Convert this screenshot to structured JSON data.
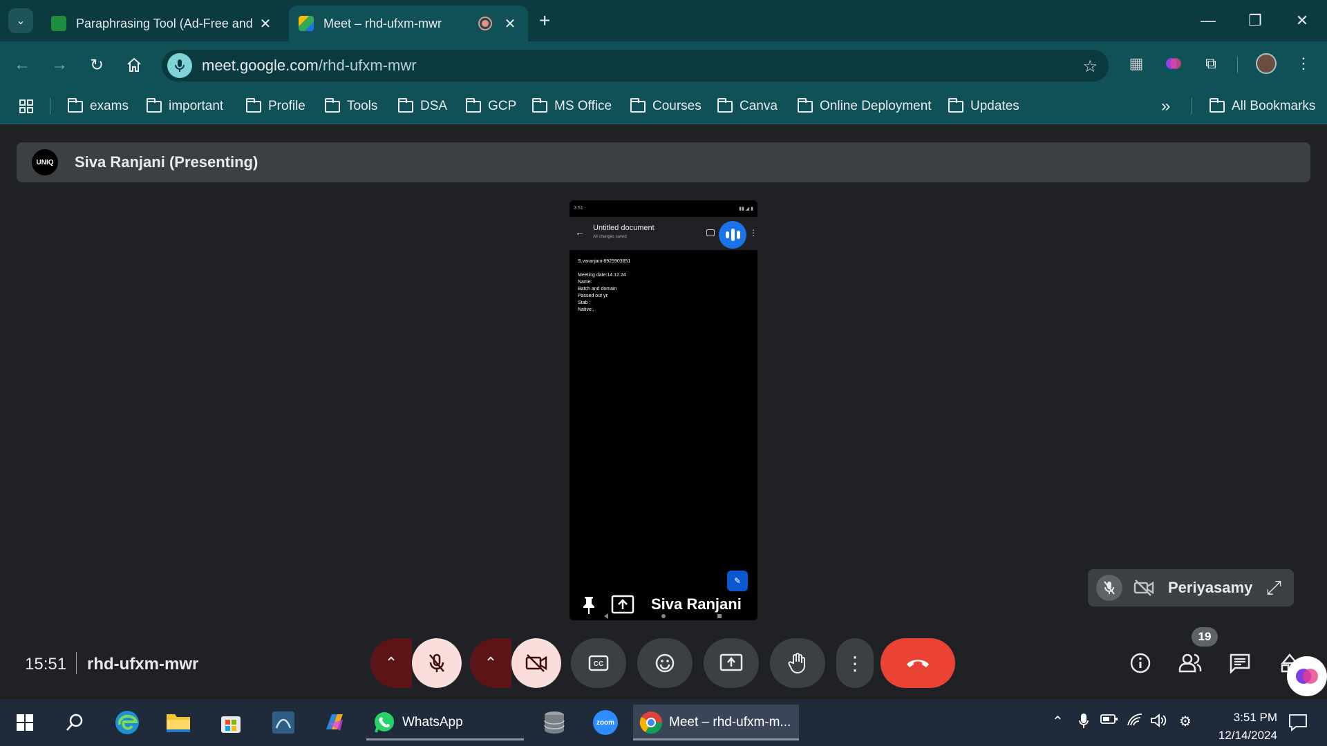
{
  "browser": {
    "tabs": [
      {
        "title": "Paraphrasing Tool (Ad-Free and",
        "favicon_color": "#1e8e3e",
        "active": false
      },
      {
        "title": "Meet – rhd-ufxm-mwr",
        "favicon_color": "#00897b",
        "active": true,
        "recording": true
      }
    ],
    "url_host": "meet.google.com",
    "url_path": "/rhd-ufxm-mwr",
    "bookmarks": [
      "exams",
      "important",
      "Profile",
      "Tools",
      "DSA",
      "GCP",
      "MS Office",
      "Courses",
      "Canva",
      "Online Deployment",
      "Updates"
    ],
    "bookmarks_overflow": "»",
    "all_bookmarks": "All Bookmarks",
    "theme_color": "#0f5156"
  },
  "meet": {
    "presenter_label": "Siva Ranjani (Presenting)",
    "avatar_text": "UNIQ",
    "shared_screen": {
      "status_time": "3:51",
      "doc_title": "Untitled document",
      "doc_subtitle": "All changes saved",
      "doc_lines": [
        "S.varanjani-8925903651",
        "",
        "Meeting date:14.12.24",
        "Name:",
        "Batch and domain",
        "Passed out yr:",
        "Stab :",
        "Native:,"
      ]
    },
    "tile_name": "Siva Ranjani",
    "self_tile_name": "Periyasamy",
    "time": "15:51",
    "meeting_code": "rhd-ufxm-mwr",
    "participant_count": "19",
    "colors": {
      "end_call": "#ea4335",
      "muted_bg": "#f9dedc",
      "muted_arrow": "#5c1417"
    }
  },
  "taskbar": {
    "whatsapp_label": "WhatsApp",
    "chrome_label": "Meet – rhd-ufxm-m...",
    "zoom_label": "zoom",
    "clock_time": "3:51 PM",
    "clock_date": "12/14/2024"
  }
}
